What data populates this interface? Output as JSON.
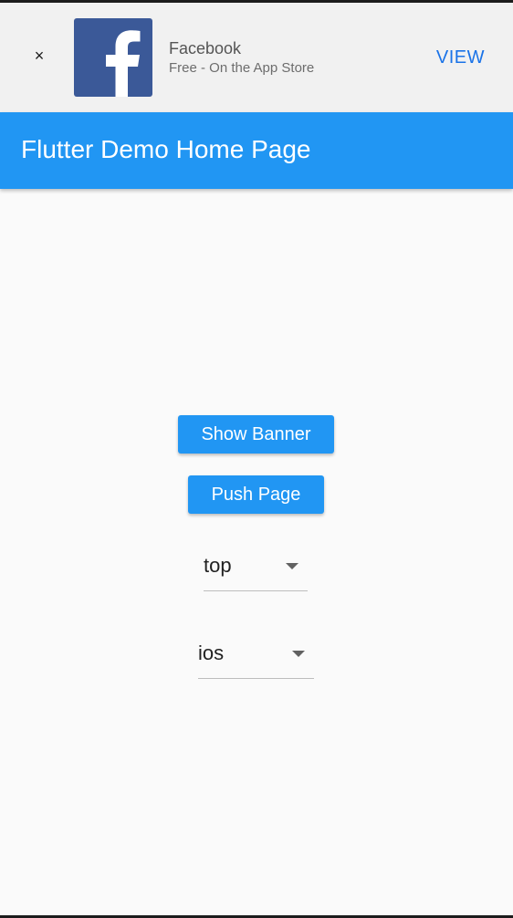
{
  "ad": {
    "close_label": "×",
    "app_name": "Facebook",
    "subtitle": "Free - On the App Store",
    "action_label": "VIEW",
    "icon": "facebook-logo-icon",
    "icon_color": "#3b5998"
  },
  "app_bar": {
    "title": "Flutter Demo Home Page",
    "color": "#2196f3"
  },
  "buttons": {
    "show_banner": "Show Banner",
    "push_page": "Push Page"
  },
  "dropdowns": {
    "position": {
      "value": "top"
    },
    "platform": {
      "value": "ios"
    }
  }
}
